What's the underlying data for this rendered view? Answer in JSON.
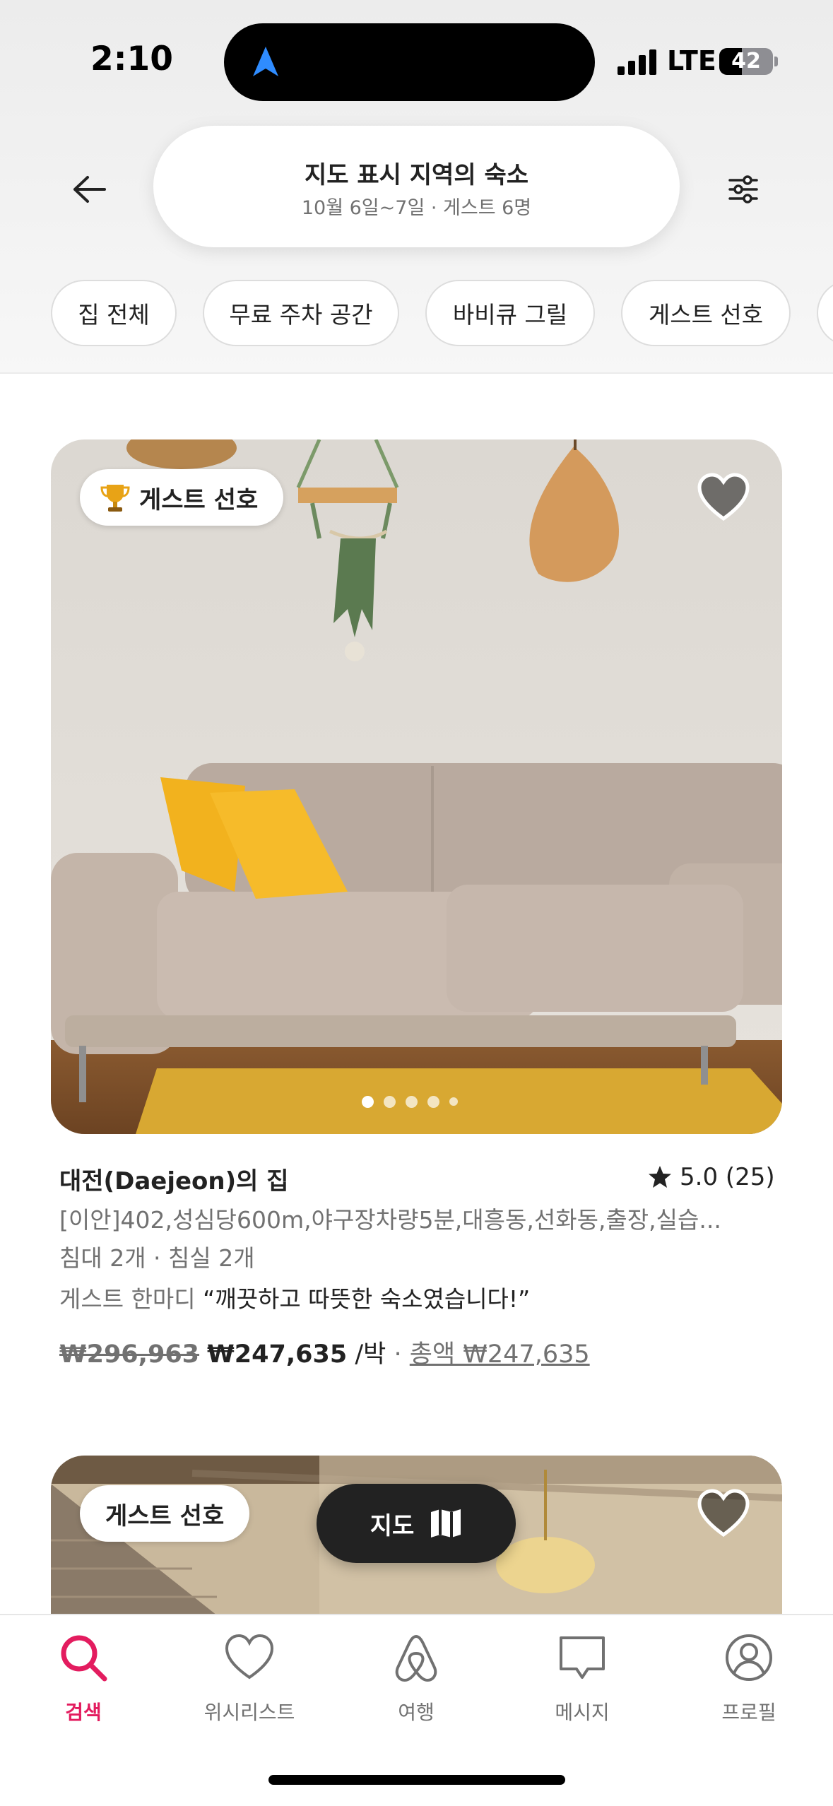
{
  "status_bar": {
    "time": "2:10",
    "network": "LTE",
    "battery_level": "42",
    "battery_fraction": 0.42
  },
  "header": {
    "search_title": "지도 표시 지역의 숙소",
    "search_subtitle": "10월 6일~7일 · 게스트 6명"
  },
  "filter_chips": [
    {
      "label": "집 전체"
    },
    {
      "label": "무료 주차 공간"
    },
    {
      "label": "바비큐 그릴"
    },
    {
      "label": "게스트 선호"
    }
  ],
  "listings": [
    {
      "badge": "게스트 선호",
      "title": "대전(Daejeon)의 집",
      "rating": "5.0 (25)",
      "description": "[이안]402,성심당600m,야구장차량5분,대흥동,선화동,출장,실습...",
      "rooms": "침대 2개 · 침실 2개",
      "review_prefix": "게스트 한마디",
      "review_quote": "“깨끗하고 따뜻한 숙소였습니다!”",
      "price_original": "₩296,963",
      "price_discounted": "₩247,635",
      "price_unit": "/박",
      "price_total": "총액 ₩247,635",
      "photo_count": 5,
      "photo_index": 1
    },
    {
      "badge": "게스트 선호"
    }
  ],
  "map_button": {
    "label": "지도"
  },
  "tab_bar": [
    {
      "label": "검색",
      "icon": "search-icon",
      "active": true
    },
    {
      "label": "위시리스트",
      "icon": "heart-icon",
      "active": false
    },
    {
      "label": "여행",
      "icon": "airbnb-logo-icon",
      "active": false
    },
    {
      "label": "메시지",
      "icon": "message-icon",
      "active": false
    },
    {
      "label": "프로필",
      "icon": "profile-icon",
      "active": false
    }
  ],
  "colors": {
    "accent": "#e31c5f",
    "text_primary": "#222222",
    "text_secondary": "#717171",
    "map_button_bg": "#222222"
  }
}
